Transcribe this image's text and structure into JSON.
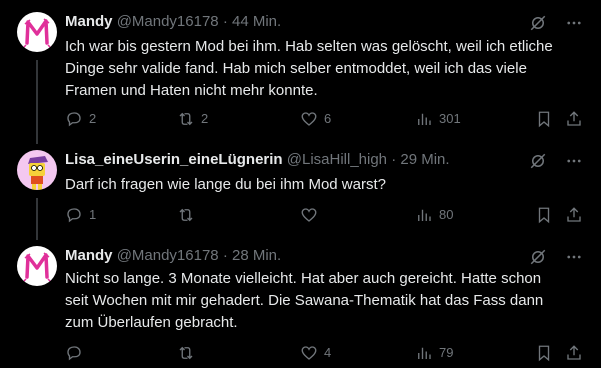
{
  "tweets": [
    {
      "name": "Mandy",
      "handle": "@Mandy16178",
      "time": "· 44 Min.",
      "lines": [
        "Ich war bis gestern Mod bei ihm. Hab selten was gelöscht, weil ich etliche",
        "Dinge sehr valide fand. Hab mich selber entmoddet, weil ich das viele",
        "Framen und Haten nicht  mehr konnte."
      ],
      "replies": "2",
      "reposts": "2",
      "likes": "6",
      "views": "301"
    },
    {
      "name": "Lisa_eineUserin_eineLügnerin",
      "handle": "@LisaHill_high",
      "time": "· 29 Min.",
      "lines": [
        "Darf ich fragen wie lange du bei ihm Mod warst?"
      ],
      "replies": "1",
      "reposts": "",
      "likes": "",
      "views": "80"
    },
    {
      "name": "Mandy",
      "handle": "@Mandy16178",
      "time": "· 28 Min.",
      "lines": [
        "Nicht so lange. 3 Monate vielleicht. Hat aber auch gereicht. Hatte schon",
        "seit Wochen mit mir gehadert. Die Sawana-Thematik hat das Fass dann",
        "zum Überlaufen gebracht."
      ],
      "replies": "",
      "reposts": "",
      "likes": "4",
      "views": "79"
    }
  ],
  "colors": {
    "background": "#000000",
    "text": "#e7e9ea",
    "muted": "#71767b",
    "mandy_avatar_bg": "#ffffff",
    "mandy_logo": "#e0309a",
    "lisa_avatar_bg": "#f4c8f0"
  },
  "icons": [
    "mute-icon",
    "more-icon",
    "reply-icon",
    "repost-icon",
    "like-icon",
    "views-icon",
    "bookmark-icon",
    "share-icon"
  ]
}
